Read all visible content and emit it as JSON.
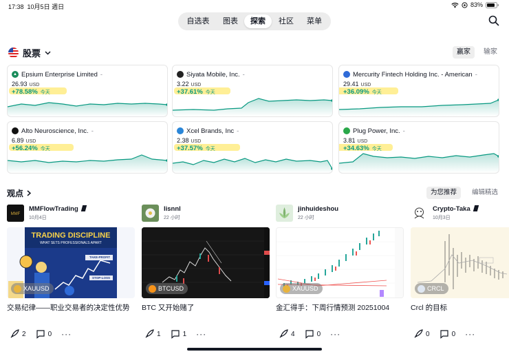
{
  "status_bar": {
    "time": "17:38",
    "date": "10月5日 週日",
    "battery": "83%"
  },
  "nav": {
    "tabs": [
      "自选表",
      "图表",
      "探索",
      "社区",
      "菜单"
    ],
    "active": "探索"
  },
  "stocks": {
    "title": "股票",
    "toggle_gainers": "赢家",
    "toggle_losers": "输家",
    "currency": "USD",
    "today_label": "今天",
    "cards": [
      {
        "name": "Epsium Enterprise Limited",
        "price": "26.93",
        "change": "+78.58%",
        "logo_color": "#1a8c5b"
      },
      {
        "name": "Siyata Mobile, Inc.",
        "price": "3.22",
        "change": "+37.61%",
        "logo_color": "#222222"
      },
      {
        "name": "Mercurity Fintech Holding Inc. - American",
        "price": "29.41",
        "change": "+36.09%",
        "logo_color": "#2f6bd8"
      },
      {
        "name": "Alto Neuroscience, Inc.",
        "price": "6.89",
        "change": "+56.24%",
        "logo_color": "#111111"
      },
      {
        "name": "Xcel Brands, Inc",
        "price": "2.38",
        "change": "+37.57%",
        "logo_color": "#2a86d8"
      },
      {
        "name": "Plug Power, Inc.",
        "price": "3.81",
        "change": "+34.63%",
        "logo_color": "#2aa84a"
      }
    ]
  },
  "ideas": {
    "title": "观点",
    "tab_for_you": "为您推荐",
    "tab_editors": "编辑精选",
    "items": [
      {
        "author": "MMFlowTrading",
        "verified": true,
        "time": "10月4日",
        "symbol": "XAUUSD",
        "title": "交易纪律——职业交易者的决定性优势",
        "boosts": "2",
        "comments": "0",
        "thumb_heading": "TRADING DISCIPLINE",
        "thumb_sub": "WHAT SETS PROFESSIONALS APART",
        "thumb_tp": "TAKE-PROFIT",
        "thumb_sl": "STOP-LOSS"
      },
      {
        "author": "lisnnl",
        "verified": false,
        "time": "22 小时",
        "symbol": "BTCUSD",
        "title": "BTC 又开始赌了",
        "boosts": "1",
        "comments": "1"
      },
      {
        "author": "jinhuideshou",
        "verified": false,
        "time": "22 小时",
        "symbol": "XAUUSD",
        "title": "金汇得手：下周行情预测 20251004",
        "boosts": "4",
        "comments": "0"
      },
      {
        "author": "Crypto-Taka",
        "verified": true,
        "time": "10月3日",
        "symbol": "CRCL",
        "title": "Crcl 的目标",
        "boosts": "0",
        "comments": "0"
      }
    ]
  },
  "colors": {
    "positive": "#089981",
    "highlight": "#ffe450",
    "accent": "#2962ff"
  }
}
